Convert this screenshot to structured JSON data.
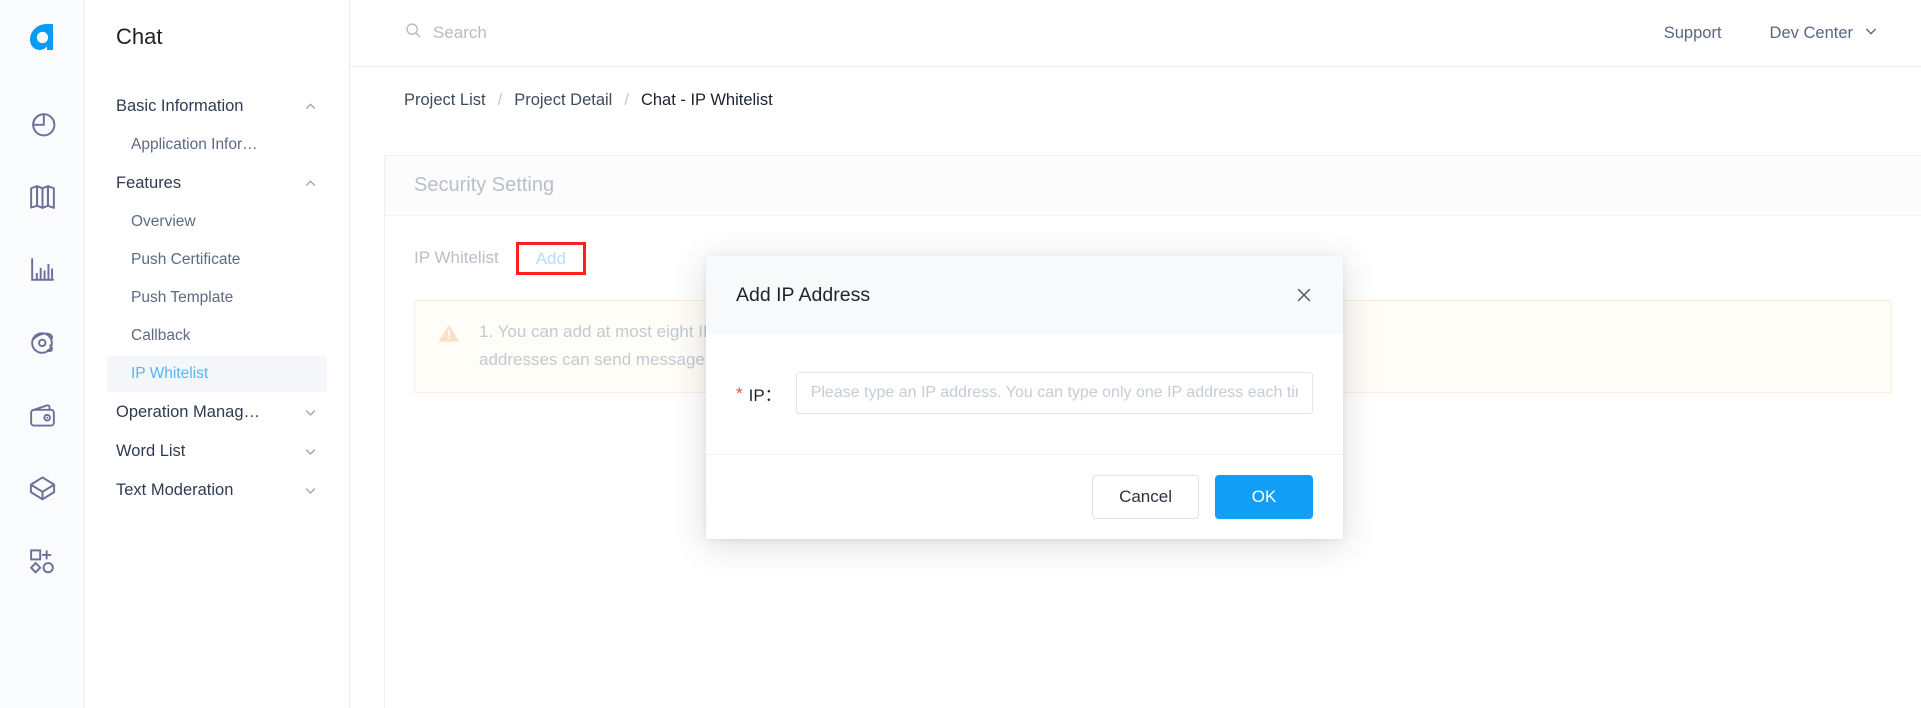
{
  "brand": {
    "icon": "agora-logo-icon",
    "color": "#0a9bf5"
  },
  "rail": {
    "items": [
      {
        "icon": "pie-chart-icon",
        "name": "rail-item-analytics"
      },
      {
        "icon": "map-book-icon",
        "name": "rail-item-guide"
      },
      {
        "icon": "bar-chart-icon",
        "name": "rail-item-usage"
      },
      {
        "icon": "monitor-eye-icon",
        "name": "rail-item-monitor"
      },
      {
        "icon": "wallet-icon",
        "name": "rail-item-billing"
      },
      {
        "icon": "package-icon",
        "name": "rail-item-products"
      },
      {
        "icon": "add-shapes-icon",
        "name": "rail-item-more"
      }
    ]
  },
  "nav": {
    "title": "Chat",
    "groups": [
      {
        "label": "Basic Information",
        "chevron": "chevron-up-icon",
        "items": [
          {
            "label": "Application Infor…",
            "active": false
          }
        ]
      },
      {
        "label": "Features",
        "chevron": "chevron-up-icon",
        "items": [
          {
            "label": "Overview",
            "active": false
          },
          {
            "label": "Push Certificate",
            "active": false
          },
          {
            "label": "Push Template",
            "active": false
          },
          {
            "label": "Callback",
            "active": false
          },
          {
            "label": "IP Whitelist",
            "active": true
          }
        ]
      },
      {
        "label": "Operation Manag…",
        "chevron": "chevron-down-icon",
        "items": []
      },
      {
        "label": "Word List",
        "chevron": "chevron-down-icon",
        "items": []
      },
      {
        "label": "Text Moderation",
        "chevron": "chevron-down-icon",
        "items": []
      }
    ]
  },
  "topbar": {
    "search": {
      "placeholder": "Search",
      "value": "",
      "icon": "search-icon"
    },
    "support_label": "Support",
    "dev_center_label": "Dev Center",
    "dev_center_chevron": "chevron-down-icon"
  },
  "breadcrumb": {
    "separator": "/",
    "items": [
      {
        "label": "Project List",
        "current": false
      },
      {
        "label": "Project Detail",
        "current": false
      },
      {
        "label": "Chat - IP Whitelist",
        "current": true
      }
    ]
  },
  "card": {
    "header_title": "Security Setting",
    "row_label": "IP Whitelist",
    "add_label": "Add",
    "highlight_color": "#ff1f1f",
    "notice": {
      "icon": "warning-triangle-icon",
      "line1": "1. You can add at most eight IP addresses to the whitelist. When the IP whitelist is empty, requests from all IP",
      "line2": "addresses can send messages via the Chat RESTful API."
    }
  },
  "dialog": {
    "title": "Add IP Address",
    "close_icon": "close-icon",
    "required_mark": "*",
    "field_label": "IP：",
    "input": {
      "placeholder": "Please type an IP address. You can type only one IP address each time.",
      "value": ""
    },
    "cancel_label": "Cancel",
    "ok_label": "OK",
    "ok_color": "#129ef5"
  }
}
